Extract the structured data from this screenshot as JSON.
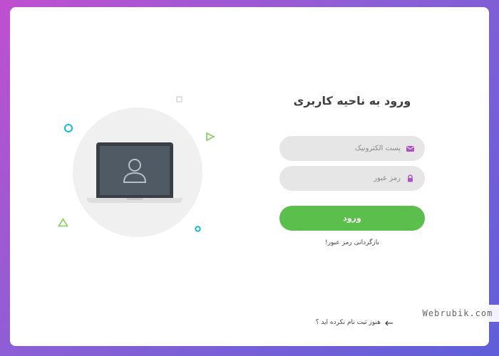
{
  "login": {
    "title": "ورود به ناحیه کاربری",
    "email_placeholder": "پست الکترونیک",
    "password_placeholder": "رمز عبور",
    "submit_label": "ورود",
    "forgot_link": "بازگردانی رمز عبور!",
    "register_link": "هنوز ثبت نام نکرده اید ؟"
  },
  "watermark": {
    "text": "Webrubik.com"
  },
  "icons": {
    "email": "envelope-icon",
    "password": "lock-icon",
    "user": "user-icon",
    "register_arrow": "arrow-left-icon"
  },
  "colors": {
    "accent_green": "#5bbf4c",
    "input_bg": "#e6e6e6",
    "icon_purple": "#b14fc8",
    "background_gradient_start": "#c04fd0",
    "background_gradient_end": "#5f5fd8"
  }
}
